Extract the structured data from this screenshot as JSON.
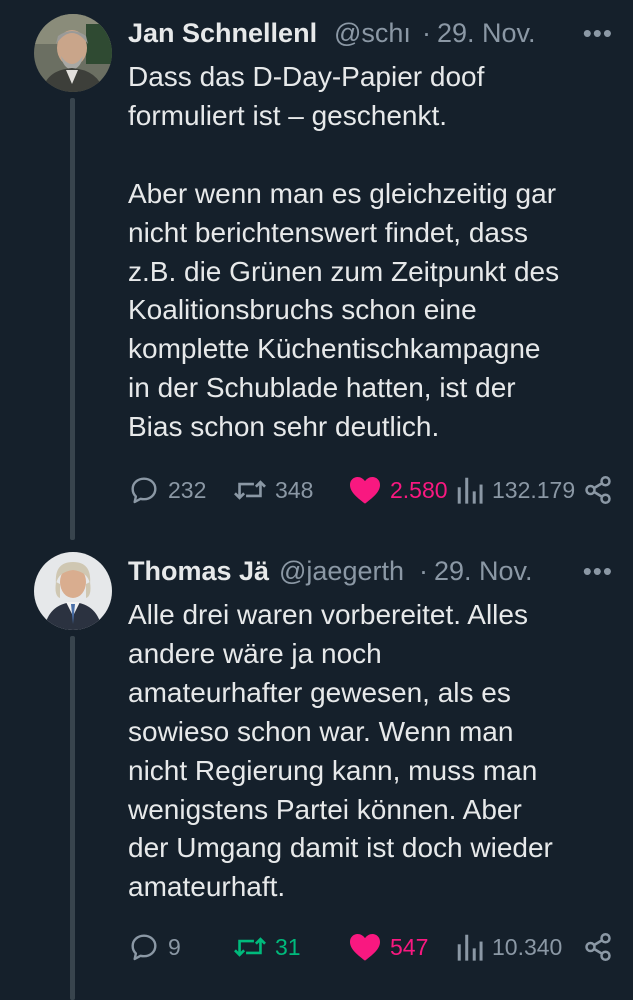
{
  "colors": {
    "background": "#15202b",
    "text": "#e7e9ea",
    "muted": "#8b98a5",
    "like": "#f91880",
    "retweet": "#00ba7c",
    "thread_line": "#38444d"
  },
  "tweets": [
    {
      "name": "Jan Schnellenl",
      "handle": "@schı",
      "separator": "·",
      "date": "29. Nov.",
      "more": "•••",
      "text": "Dass das D-Day-Papier doof\nformuliert ist – geschenkt.\n\nAber wenn man es gleichzeitig gar\nnicht berichtenswert findet, dass\nz.B. die Grünen zum Zeitpunkt des\nKoalitionsbruchs schon eine\nkomplette Küchentischkampagne\nin der Schublade hatten, ist der\nBias schon sehr deutlich.",
      "replies": "232",
      "retweets": "348",
      "likes": "2.580",
      "views": "132.179",
      "liked": true,
      "retweeted": false,
      "avatar_icon": "profile-photo"
    },
    {
      "name": "Thomas Jä",
      "handle": "@jaegerth",
      "separator": "·",
      "date": "29. Nov.",
      "more": "•••",
      "text": "Alle drei waren vorbereitet. Alles\nandere wäre ja noch\namateurhafter gewesen, als es\nsowieso schon war. Wenn man\nnicht Regierung kann, muss man\nwenigstens Partei können. Aber\nder Umgang damit ist doch wieder\namateurhaft.",
      "replies": "9",
      "retweets": "31",
      "likes": "547",
      "views": "10.340",
      "liked": true,
      "retweeted": true,
      "avatar_icon": "profile-photo"
    }
  ]
}
